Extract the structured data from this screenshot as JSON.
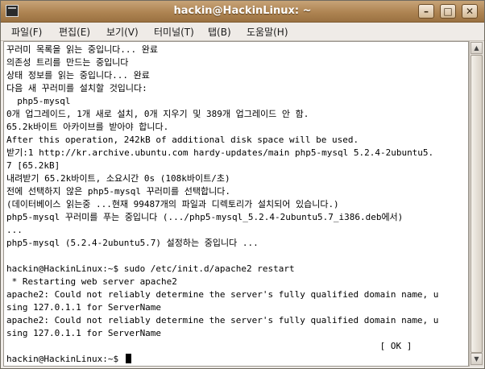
{
  "window": {
    "title": "hackin@HackinLinux: ~"
  },
  "menu": [
    "파일(F)",
    "편집(E)",
    "보기(V)",
    "터미널(T)",
    "탭(B)",
    "도움말(H)"
  ],
  "terminal": {
    "lines": [
      "꾸러미 목록을 읽는 중입니다... 완료",
      "의존성 트리를 만드는 중입니다",
      "상태 정보를 읽는 중입니다... 완료",
      "다음 새 꾸러미를 설치할 것입니다:",
      "  php5-mysql",
      "0개 업그레이드, 1개 새로 설치, 0개 지우기 및 389개 업그레이드 안 함.",
      "65.2k바이트 아카이브를 받아야 합니다.",
      "After this operation, 242kB of additional disk space will be used.",
      "받기:1 http://kr.archive.ubuntu.com hardy-updates/main php5-mysql 5.2.4-2ubuntu5.",
      "7 [65.2kB]",
      "내려받기 65.2k바이트, 소요시간 0s (108k바이트/초)",
      "전에 선택하지 않은 php5-mysql 꾸러미를 선택합니다.",
      "(데이터베이스 읽는중 ...현재 99487개의 파일과 디렉토리가 설치되어 있습니다.)",
      "php5-mysql 꾸러미를 푸는 중입니다 (.../php5-mysql_5.2.4-2ubuntu5.7_i386.deb에서)",
      "...",
      "php5-mysql (5.2.4-2ubuntu5.7) 설정하는 중입니다 ...",
      "",
      "hackin@HackinLinux:~$ sudo /etc/init.d/apache2 restart",
      " * Restarting web server apache2",
      "apache2: Could not reliably determine the server's fully qualified domain name, u",
      "sing 127.0.1.1 for ServerName",
      "apache2: Could not reliably determine the server's fully qualified domain name, u",
      "sing 127.0.1.1 for ServerName",
      "                                                                      [ OK ]",
      "hackin@HackinLinux:~$ "
    ]
  }
}
